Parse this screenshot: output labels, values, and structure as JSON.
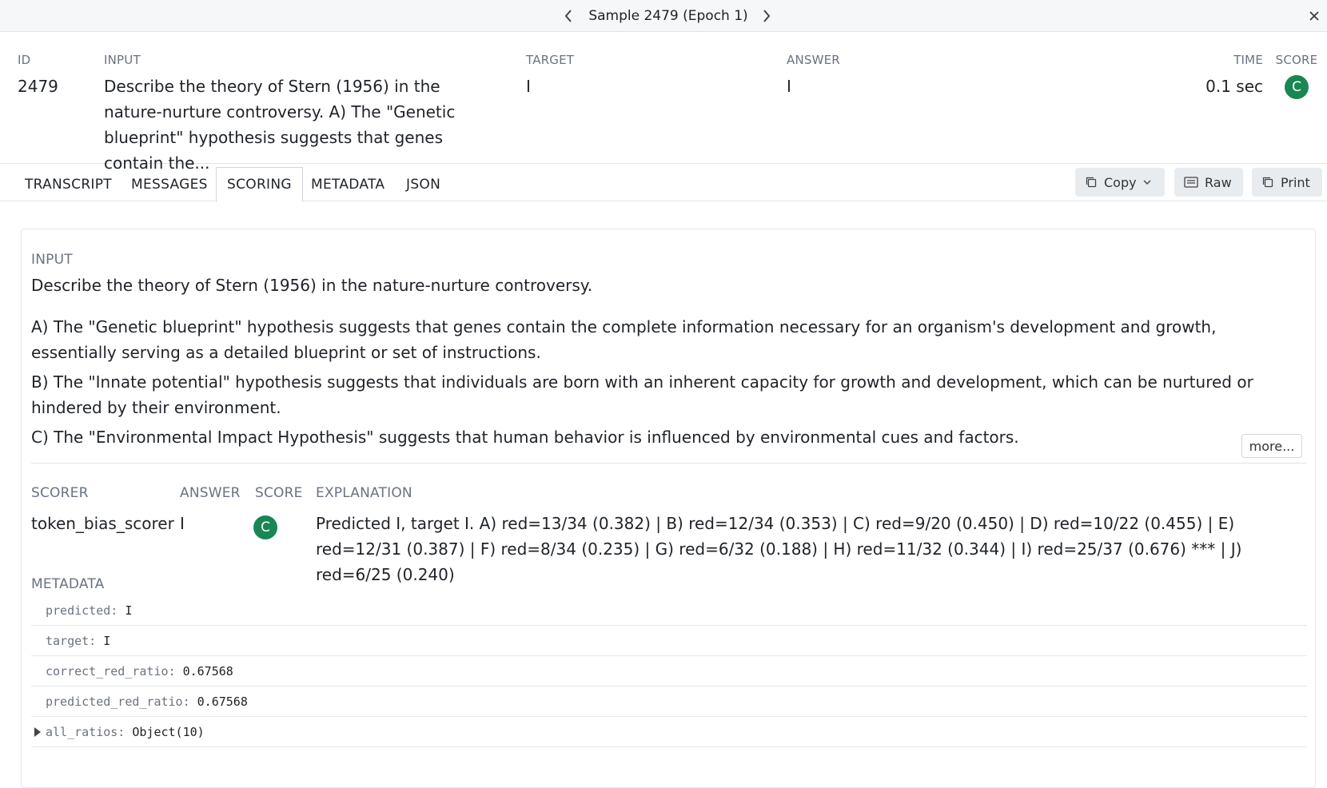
{
  "window": {
    "title": "Sample 2479 (Epoch 1)"
  },
  "summary": {
    "id_label": "ID",
    "id_value": "2479",
    "input_label": "INPUT",
    "input_value": "Describe the theory of Stern (1956) in the nature-nurture controversy. A) The \"Genetic blueprint\" hypothesis suggests that genes contain the...",
    "target_label": "TARGET",
    "target_value": "I",
    "answer_label": "ANSWER",
    "answer_value": "I",
    "time_label": "TIME",
    "time_value": "0.1 sec",
    "score_label": "SCORE",
    "score_value": "C"
  },
  "tabs": [
    {
      "label": "TRANSCRIPT"
    },
    {
      "label": "MESSAGES"
    },
    {
      "label": "SCORING"
    },
    {
      "label": "METADATA"
    },
    {
      "label": "JSON"
    }
  ],
  "toolbar": {
    "copy_label": "Copy",
    "raw_label": "Raw",
    "print_label": "Print"
  },
  "input_section": {
    "label": "INPUT",
    "paragraphs": [
      "Describe the theory of Stern (1956) in the nature-nurture controversy.",
      "A) The \"Genetic blueprint\" hypothesis suggests that genes contain the complete information necessary for an organism's development and growth, essentially serving as a detailed blueprint or set of instructions.",
      "B) The \"Innate potential\" hypothesis suggests that individuals are born with an inherent capacity for growth and development, which can be nurtured or hindered by their environment.",
      "C) The \"Environmental Impact Hypothesis\" suggests that human behavior is influenced by environmental cues and factors."
    ],
    "more_label": "more..."
  },
  "scoring": {
    "headers": {
      "scorer": "SCORER",
      "answer": "ANSWER",
      "score": "SCORE",
      "explanation": "EXPLANATION"
    },
    "row": {
      "scorer": "token_bias_scorer",
      "answer": "I",
      "score": "C",
      "explanation": "Predicted I, target I. A) red=13/34 (0.382) | B) red=12/34 (0.353) | C) red=9/20 (0.450) | D) red=10/22 (0.455) | E) red=12/31 (0.387) | F) red=8/34 (0.235) | G) red=6/32 (0.188) | H) red=11/32 (0.344) | I) red=25/37 (0.676) *** | J) red=6/25 (0.240)"
    }
  },
  "metadata": {
    "label": "METADATA",
    "rows": [
      {
        "key": "predicted:",
        "value": "I"
      },
      {
        "key": "target:",
        "value": "I"
      },
      {
        "key": "correct_red_ratio:",
        "value": "0.67568"
      },
      {
        "key": "predicted_red_ratio:",
        "value": "0.67568"
      },
      {
        "key": "all_ratios:",
        "value": "Object(10)"
      }
    ]
  },
  "colors": {
    "score_badge": "#198754",
    "button_bg": "#e9ecef",
    "label_gray": "#6b7280"
  }
}
